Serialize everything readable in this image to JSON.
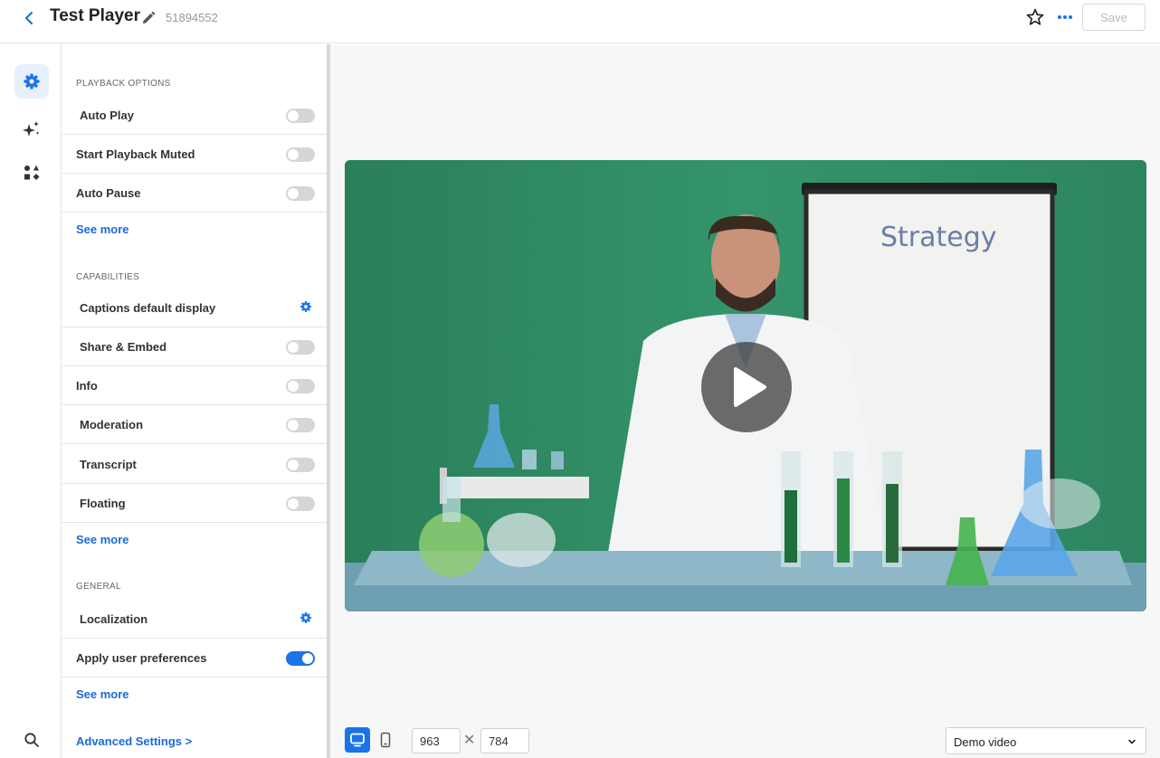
{
  "header": {
    "title": "Test Player",
    "player_id": "51894552",
    "save_label": "Save"
  },
  "rail": {
    "icons": [
      "gear-icon",
      "sparkles-icon",
      "shapes-icon",
      "search-icon"
    ]
  },
  "playback_options": {
    "title": "PLAYBACK OPTIONS",
    "items": [
      {
        "label": "Auto Play",
        "control": "toggle",
        "on": false
      },
      {
        "label": "Start Playback Muted",
        "control": "toggle",
        "on": false
      },
      {
        "label": "Auto Pause",
        "control": "toggle",
        "on": false
      }
    ],
    "see_more": "See more"
  },
  "capabilities": {
    "title": "CAPABILITIES",
    "items": [
      {
        "label": "Captions default display",
        "control": "gear"
      },
      {
        "label": "Share & Embed",
        "control": "toggle",
        "on": false
      },
      {
        "label": "Info",
        "control": "toggle",
        "on": false
      },
      {
        "label": "Moderation",
        "control": "toggle",
        "on": false
      },
      {
        "label": "Transcript",
        "control": "toggle",
        "on": false
      },
      {
        "label": "Floating",
        "control": "toggle",
        "on": false
      }
    ],
    "see_more": "See more"
  },
  "general": {
    "title": "GENERAL",
    "items": [
      {
        "label": "Localization",
        "control": "gear"
      },
      {
        "label": "Apply user preferences",
        "control": "toggle",
        "on": true
      }
    ],
    "see_more": "See more"
  },
  "advanced_settings": "Advanced Settings >",
  "preview": {
    "whiteboard_text": "Strategy",
    "width_value": "963",
    "height_value": "784",
    "separator": "✕",
    "video_select": "Demo video"
  },
  "colors": {
    "accent": "#1a73e8",
    "link": "#1a6ad8",
    "green_screen": "#2f8a63"
  }
}
